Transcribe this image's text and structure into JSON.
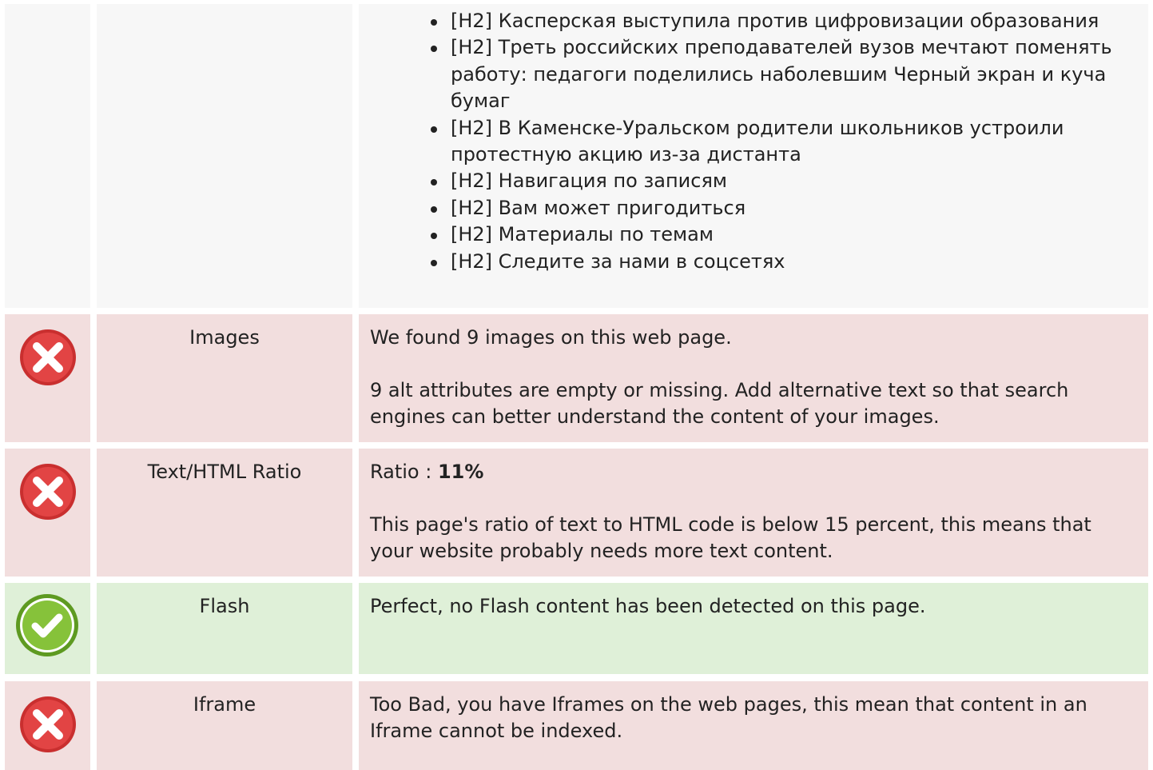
{
  "headings_row": {
    "items": [
      "[H2] Касперская выступила против цифровизации образования",
      "[H2] Треть российских преподавателей вузов мечтают поменять работу: педагоги поделились наболевшим Черный экран и куча бумаг",
      "[H2] В Каменске-Уральском родители школьников устроили протестную акцию из-за дистанта",
      "[H2] Навигация по записям",
      "[H2] Вам может пригодиться",
      "[H2] Материалы по темам",
      "[H2] Следите за нами в соцсетях"
    ]
  },
  "rows": {
    "images": {
      "status": "fail",
      "status_icon": "error-icon",
      "name": "Images",
      "line1": "We found 9 images on this web page.",
      "line2": "9 alt attributes are empty or missing. Add alternative text so that search engines can better understand the content of your images."
    },
    "ratio": {
      "status": "fail",
      "status_icon": "error-icon",
      "name": "Text/HTML Ratio",
      "ratio_label": "Ratio : ",
      "ratio_value": "11%",
      "line2": "This page's ratio of text to HTML code is below 15 percent, this means that your website probably needs more text content."
    },
    "flash": {
      "status": "pass",
      "status_icon": "check-icon",
      "name": "Flash",
      "line1": "Perfect, no Flash content has been detected on this page."
    },
    "iframe": {
      "status": "fail",
      "status_icon": "error-icon",
      "name": "Iframe",
      "line1": "Too Bad, you have Iframes on the web pages, this mean that content in an Iframe cannot be indexed."
    }
  },
  "colors": {
    "fail_bg": "#f2dede",
    "pass_bg": "#dff0d8",
    "neutral_bg": "#f7f7f7",
    "error_icon": "#e03e3e",
    "check_icon": "#7fc234"
  }
}
